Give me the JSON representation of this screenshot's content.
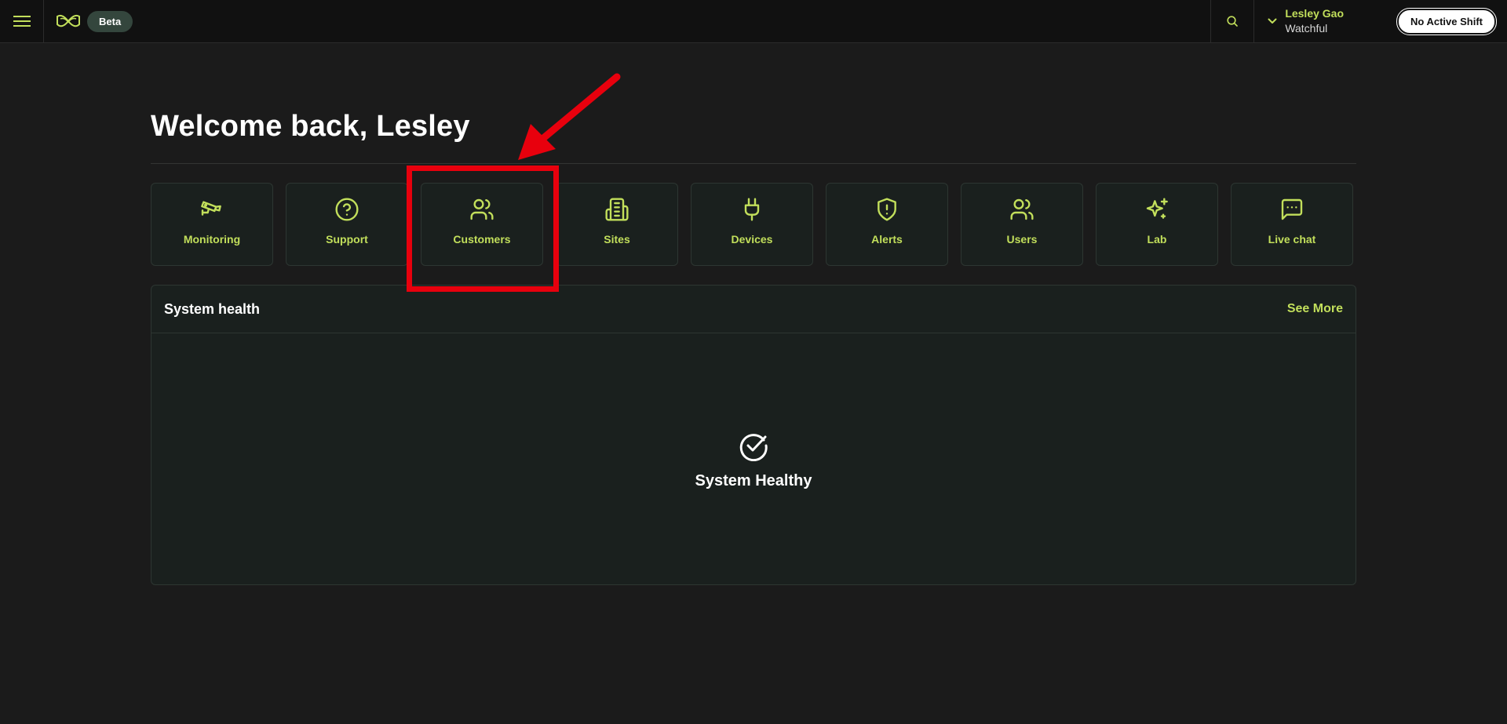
{
  "header": {
    "beta_label": "Beta",
    "user_name": "Lesley Gao",
    "user_status": "Watchful",
    "shift_button": "No Active Shift"
  },
  "main": {
    "welcome": "Welcome back, Lesley",
    "tiles": [
      {
        "label": "Monitoring",
        "icon": "cctv-camera-icon"
      },
      {
        "label": "Support",
        "icon": "help-circle-icon"
      },
      {
        "label": "Customers",
        "icon": "users-icon"
      },
      {
        "label": "Sites",
        "icon": "building-icon"
      },
      {
        "label": "Devices",
        "icon": "plug-icon"
      },
      {
        "label": "Alerts",
        "icon": "shield-alert-icon"
      },
      {
        "label": "Users",
        "icon": "users-icon"
      },
      {
        "label": "Lab",
        "icon": "sparkles-icon"
      },
      {
        "label": "Live chat",
        "icon": "message-square-icon"
      }
    ]
  },
  "system_health": {
    "title": "System health",
    "see_more": "See More",
    "status": "System Healthy"
  },
  "colors": {
    "accent": "#c2df5b",
    "background": "#1b1b1b",
    "card": "#1a201e",
    "annotation": "#e8000d"
  }
}
